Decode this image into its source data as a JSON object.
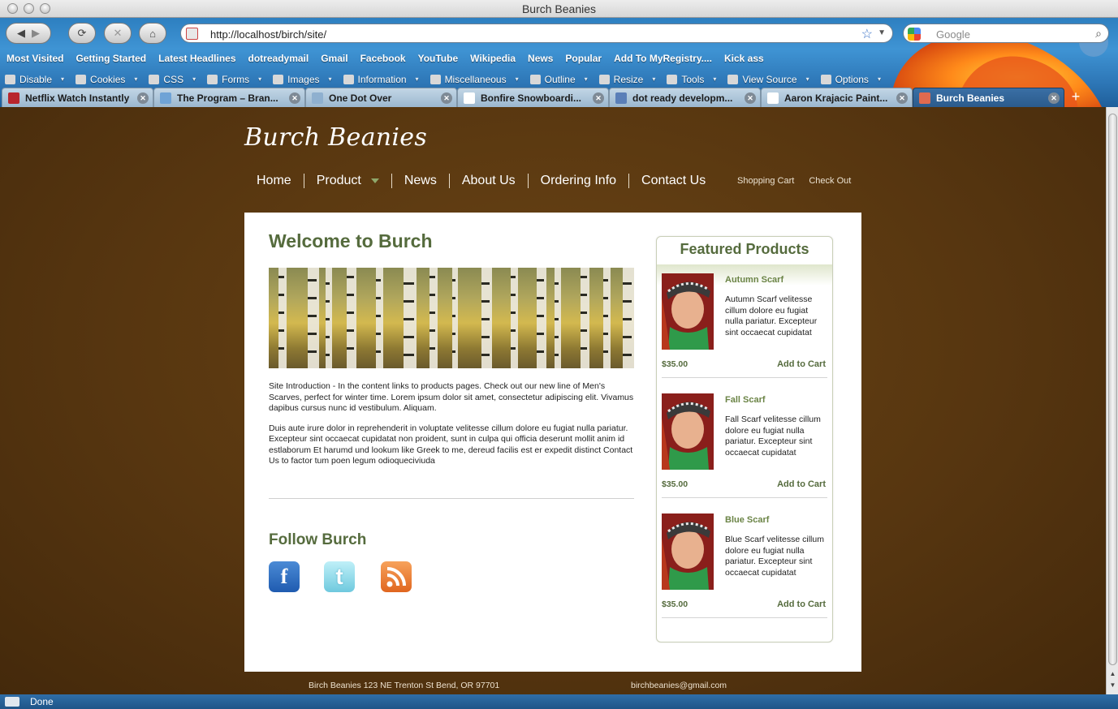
{
  "window": {
    "title": "Burch Beanies"
  },
  "toolbar": {
    "back_label": "◀",
    "forward_label": "▶",
    "reload_label": "⟳",
    "stop_label": "✕",
    "home_label": "⌂",
    "url": "http://localhost/birch/site/",
    "search_placeholder": "Google"
  },
  "bookmarks": [
    "Most Visited",
    "Getting Started",
    "Latest Headlines",
    "dotreadymail",
    "Gmail",
    "Facebook",
    "YouTube",
    "Wikipedia",
    "News",
    "Popular",
    "Add To MyRegistry....",
    "Kick ass"
  ],
  "webdev": [
    "Disable",
    "Cookies",
    "CSS",
    "Forms",
    "Images",
    "Information",
    "Miscellaneous",
    "Outline",
    "Resize",
    "Tools",
    "View Source",
    "Options"
  ],
  "tabs": [
    {
      "label": "Netflix Watch Instantly",
      "active": false,
      "color": "#b8262d"
    },
    {
      "label": "The Program – Bran...",
      "active": false,
      "color": "#6fa3d6"
    },
    {
      "label": "One Dot Over",
      "active": false,
      "color": "#8fb0cf"
    },
    {
      "label": "Bonfire Snowboardi...",
      "active": false,
      "color": "#ffffff"
    },
    {
      "label": "dot ready developm...",
      "active": false,
      "color": "#5a7fb8"
    },
    {
      "label": "Aaron Krajacic Paint...",
      "active": false,
      "color": "#ffffff"
    },
    {
      "label": "Burch Beanies",
      "active": true,
      "color": "#e06a4f"
    }
  ],
  "status": {
    "text": "Done"
  },
  "site": {
    "title": "Burch Beanies",
    "nav": [
      "Home",
      "Product",
      "News",
      "About Us",
      "Ordering Info",
      "Contact Us"
    ],
    "util_nav": [
      "Shopping Cart",
      "Check Out"
    ],
    "welcome": "Welcome to Burch",
    "intro_p1": "Site Introduction - In the content links to products pages. Check out our new line of Men's Scarves, perfect for winter time. Lorem ipsum dolor sit amet, consectetur adipiscing elit. Vivamus dapibus cursus nunc id vestibulum. Aliquam.",
    "intro_p2": "Duis aute irure dolor in reprehenderit in voluptate velitesse cillum dolore eu fugiat nulla pariatur. Excepteur sint occaecat cupidatat non proident, sunt in culpa qui officia deserunt mollit anim id estlaborum Et harumd und lookum like Greek to me, dereud facilis est er expedit distinct Contact Us to factor tum poen legum odioqueciviuda",
    "follow": "Follow Burch",
    "social": [
      {
        "name": "facebook",
        "glyph": "f"
      },
      {
        "name": "twitter",
        "glyph": "t"
      },
      {
        "name": "rss",
        "glyph": ""
      }
    ],
    "featured_title": "Featured Products",
    "products": [
      {
        "name": "Autumn Scarf",
        "desc": "Autumn Scarf velitesse cillum dolore eu fugiat nulla pariatur. Excepteur sint occaecat cupidatat",
        "price": "$35.00",
        "cta": "Add to Cart"
      },
      {
        "name": "Fall Scarf",
        "desc": "Fall Scarf velitesse cillum dolore eu fugiat nulla pariatur. Excepteur sint occaecat cupidatat",
        "price": "$35.00",
        "cta": "Add to Cart"
      },
      {
        "name": "Blue Scarf",
        "desc": "Blue Scarf velitesse cillum dolore eu fugiat nulla pariatur. Excepteur sint occaecat cupidatat",
        "price": "$35.00",
        "cta": "Add to Cart"
      }
    ],
    "footer_address": "Birch Beanies 123 NE Trenton St Bend, OR 97701",
    "footer_email": "birchbeanies@gmail.com"
  },
  "colors": {
    "brand_green": "#556b3d",
    "background_brown": "#5a3a12",
    "chrome_blue": "#3f94d4"
  }
}
